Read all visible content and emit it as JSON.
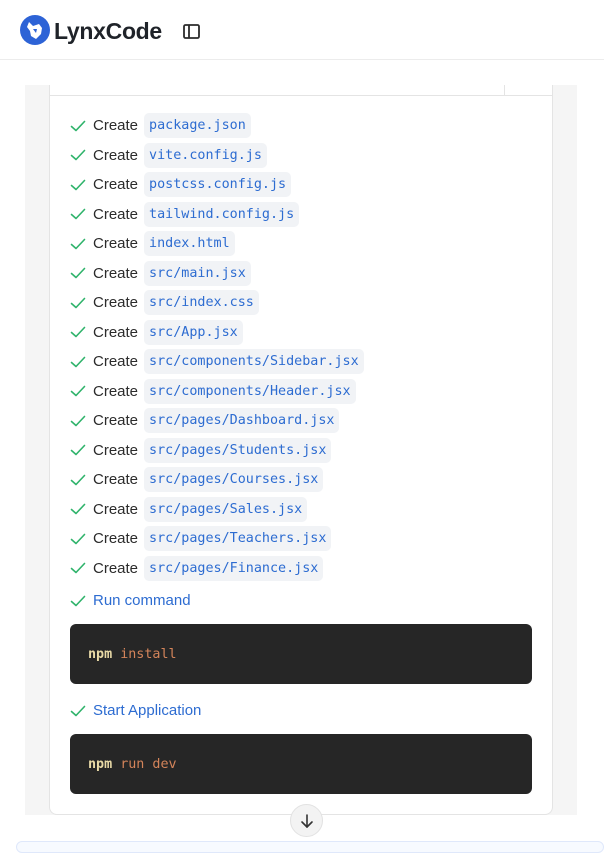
{
  "app": {
    "name": "LynxCode"
  },
  "colors": {
    "accent": "#2d6cd1",
    "check": "#2fb36b",
    "code_bg": "#262626"
  },
  "header": {
    "logo_icon": "lynx-logo-icon",
    "sidebar_toggle_icon": "sidebar-toggle-icon"
  },
  "steps": {
    "verb": "Create",
    "files": [
      "package.json",
      "vite.config.js",
      "postcss.config.js",
      "tailwind.config.js",
      "index.html",
      "src/main.jsx",
      "src/index.css",
      "src/App.jsx",
      "src/components/Sidebar.jsx",
      "src/components/Header.jsx",
      "src/pages/Dashboard.jsx",
      "src/pages/Students.jsx",
      "src/pages/Courses.jsx",
      "src/pages/Sales.jsx",
      "src/pages/Teachers.jsx",
      "src/pages/Finance.jsx"
    ]
  },
  "run_command": {
    "label": "Run command",
    "code": {
      "cmd": "npm",
      "args": "install"
    }
  },
  "start_app": {
    "label": "Start Application",
    "code": {
      "cmd": "npm",
      "args": "run dev"
    }
  },
  "scroll_button": {
    "icon": "arrow-down-icon"
  }
}
